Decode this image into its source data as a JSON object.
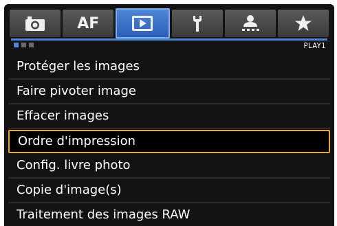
{
  "tabs": {
    "af_label": "AF",
    "active_index": 2,
    "icons": [
      "camera-icon",
      "af-text",
      "playback-icon",
      "wrench-icon",
      "custom-functions-icon",
      "star-icon"
    ]
  },
  "page_indicator": {
    "pages": 3,
    "current": 1,
    "label": "PLAY1"
  },
  "menu": {
    "items": [
      "Protéger les images",
      "Faire pivoter image",
      "Effacer images",
      "Ordre d'impression",
      "Config. livre photo",
      "Copie d'image(s)",
      "Traitement des images RAW"
    ],
    "selected_index": 3
  },
  "colors": {
    "accent": "#4f86d6",
    "highlight": "#e7a82d",
    "background": "#131313"
  }
}
